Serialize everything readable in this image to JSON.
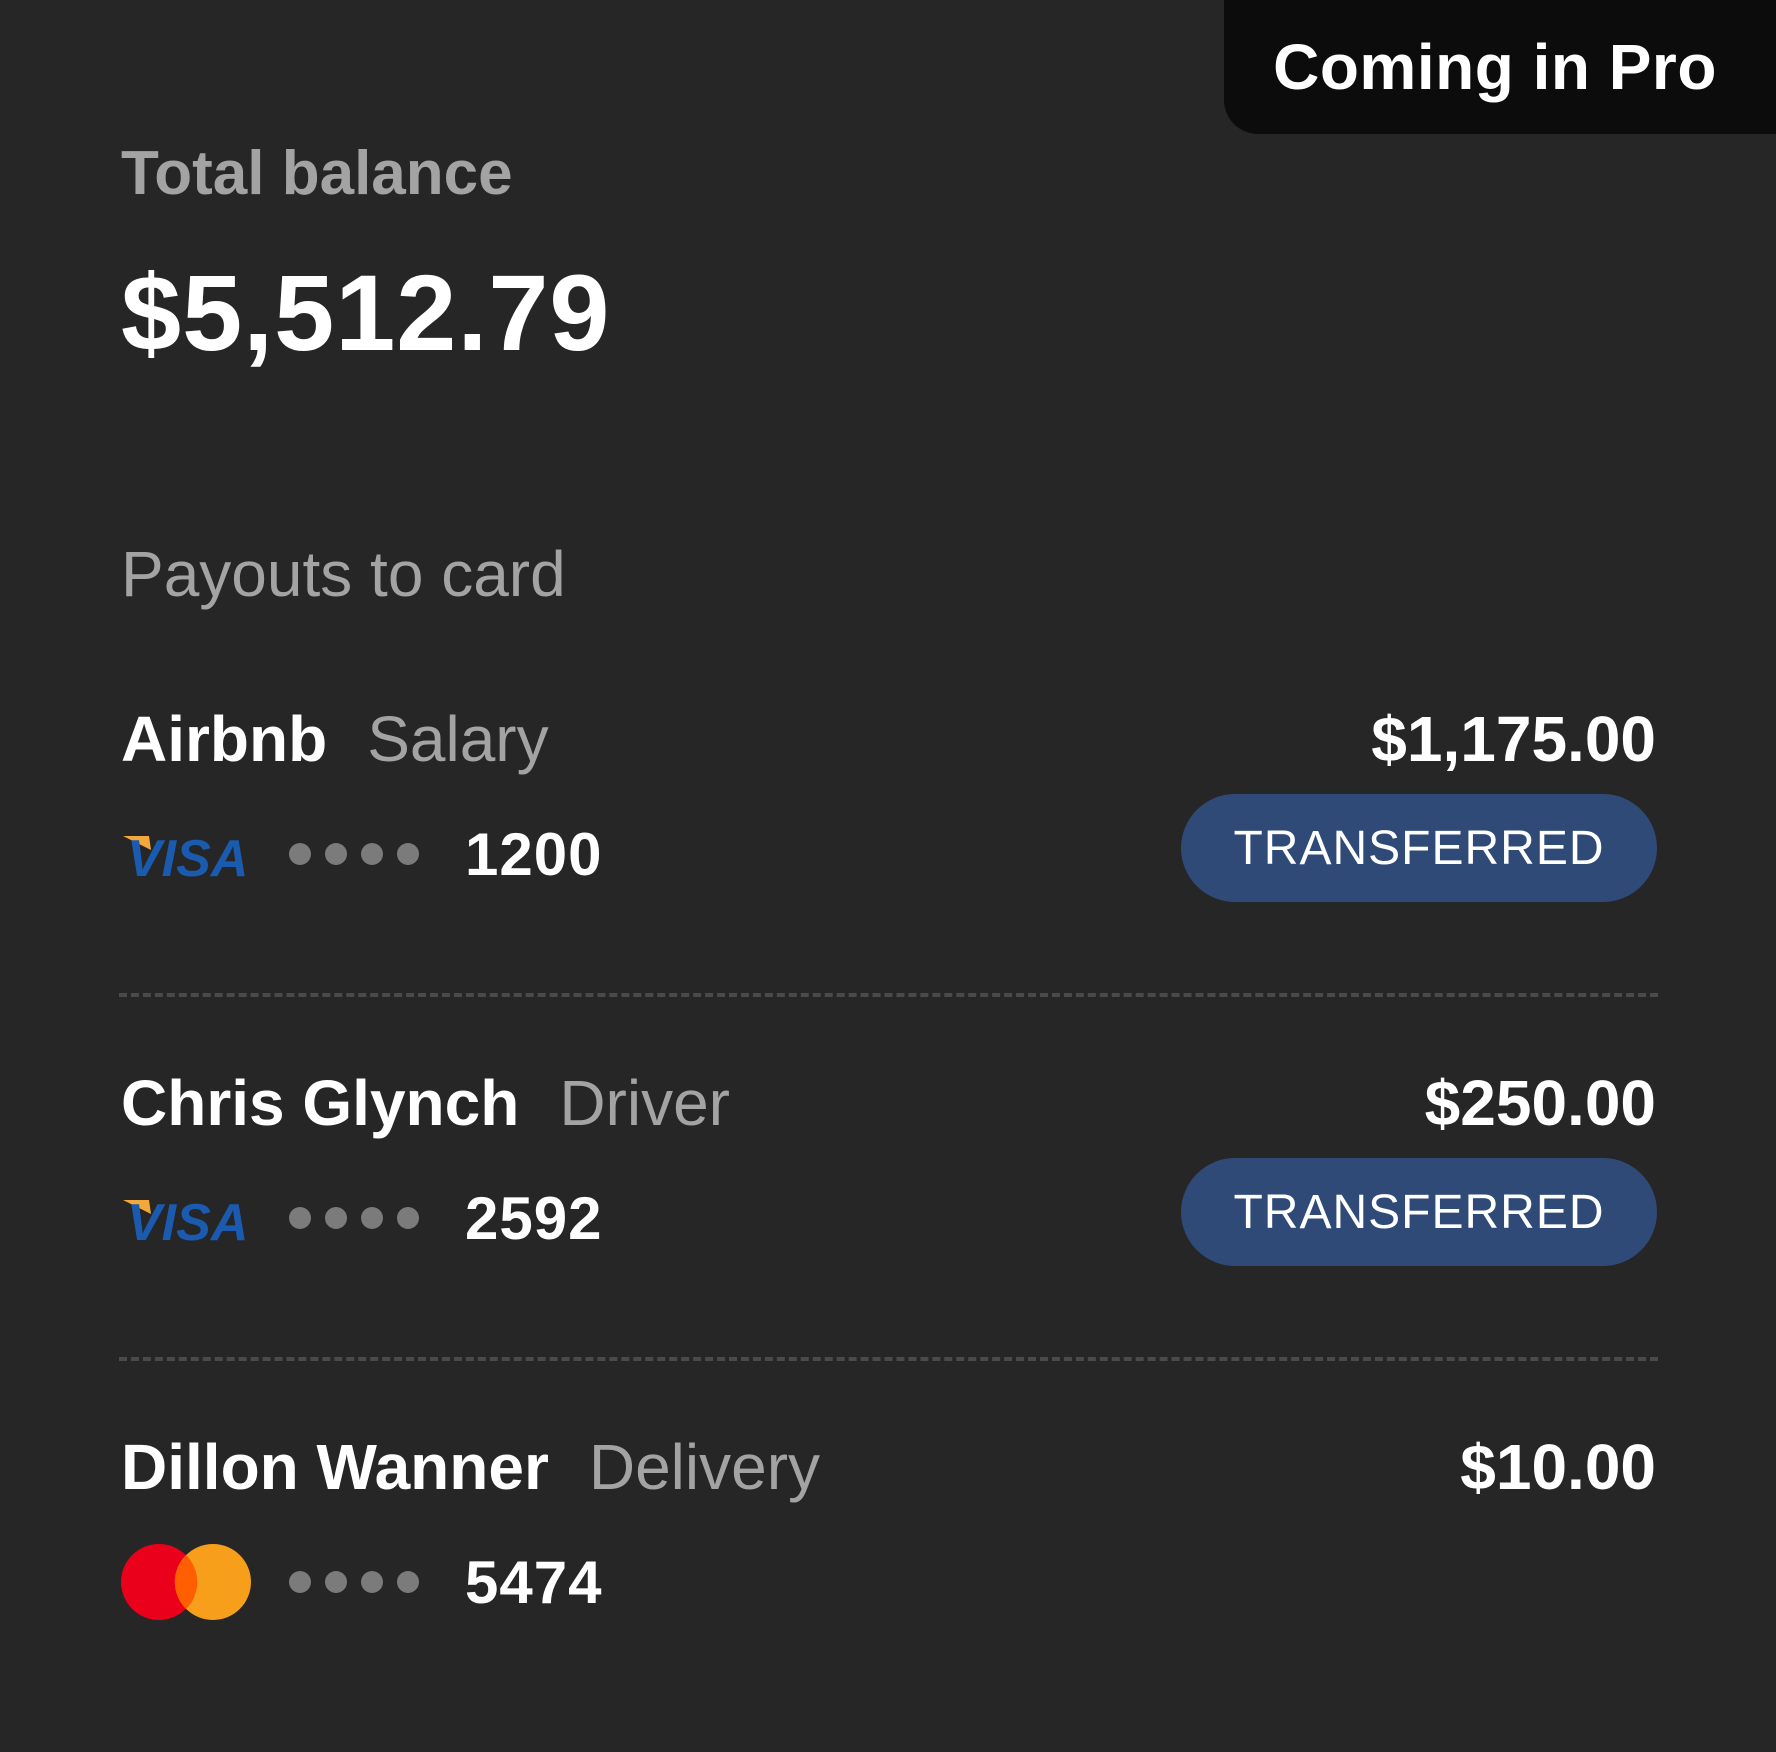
{
  "banner": {
    "label": "Coming in Pro"
  },
  "balance": {
    "label": "Total balance",
    "value": "$5,512.79"
  },
  "payouts_title": "Payouts to card",
  "payouts": [
    {
      "name": "Airbnb",
      "role": "Salary",
      "amount": "$1,175.00",
      "card_brand": "visa",
      "card_brand_label": "VISA",
      "card_mask": "●●●●",
      "last4": "1200",
      "status": "TRANSFERRED"
    },
    {
      "name": "Chris Glynch",
      "role": "Driver",
      "amount": "$250.00",
      "card_brand": "visa",
      "card_brand_label": "VISA",
      "card_mask": "●●●●",
      "last4": "2592",
      "status": "TRANSFERRED"
    },
    {
      "name": "Dillon Wanner",
      "role": "Delivery",
      "amount": "$10.00",
      "card_brand": "mastercard",
      "card_mask": "●●●●",
      "last4": "5474"
    }
  ],
  "colors": {
    "background": "#262627",
    "banner_bg": "#0c0c0c",
    "muted_text": "#a3a3a3",
    "badge_bg": "#2f4a77",
    "visa_blue": "#1a5bb0",
    "visa_gold": "#f2a83a",
    "mc_red": "#eb001b",
    "mc_orange": "#f79e1b"
  }
}
